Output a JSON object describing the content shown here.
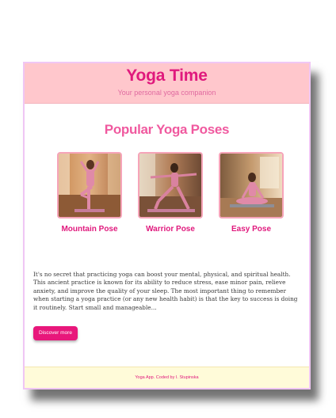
{
  "header": {
    "title": "Yoga Time",
    "subtitle": "Your personal yoga companion"
  },
  "poses": {
    "title": "Popular Yoga Poses",
    "items": [
      {
        "name": "Mountain Pose",
        "image_icon": "mountain-pose-photo"
      },
      {
        "name": "Warrior Pose",
        "image_icon": "warrior-pose-photo"
      },
      {
        "name": "Easy Pose",
        "image_icon": "easy-pose-photo"
      }
    ]
  },
  "intro": {
    "text": "It's no secret that practicing yoga can boost your mental, physical, and spiritual health. This ancient practice is known for its ability to reduce stress, ease minor pain, relieve anxiety, and improve the quality of your sleep. The most important thing to remember when starting a yoga practice (or any new health habit) is that the key to success is doing it routinely. Start small and manageable..."
  },
  "cta": {
    "label": "Discover more"
  },
  "footer": {
    "text": "Yoga App. Coded by I. Stupinska"
  },
  "colors": {
    "accent": "#e0197d",
    "header_bg": "#ffc7cc",
    "footer_bg": "#fffbd9",
    "button_bg": "#e8177b"
  }
}
